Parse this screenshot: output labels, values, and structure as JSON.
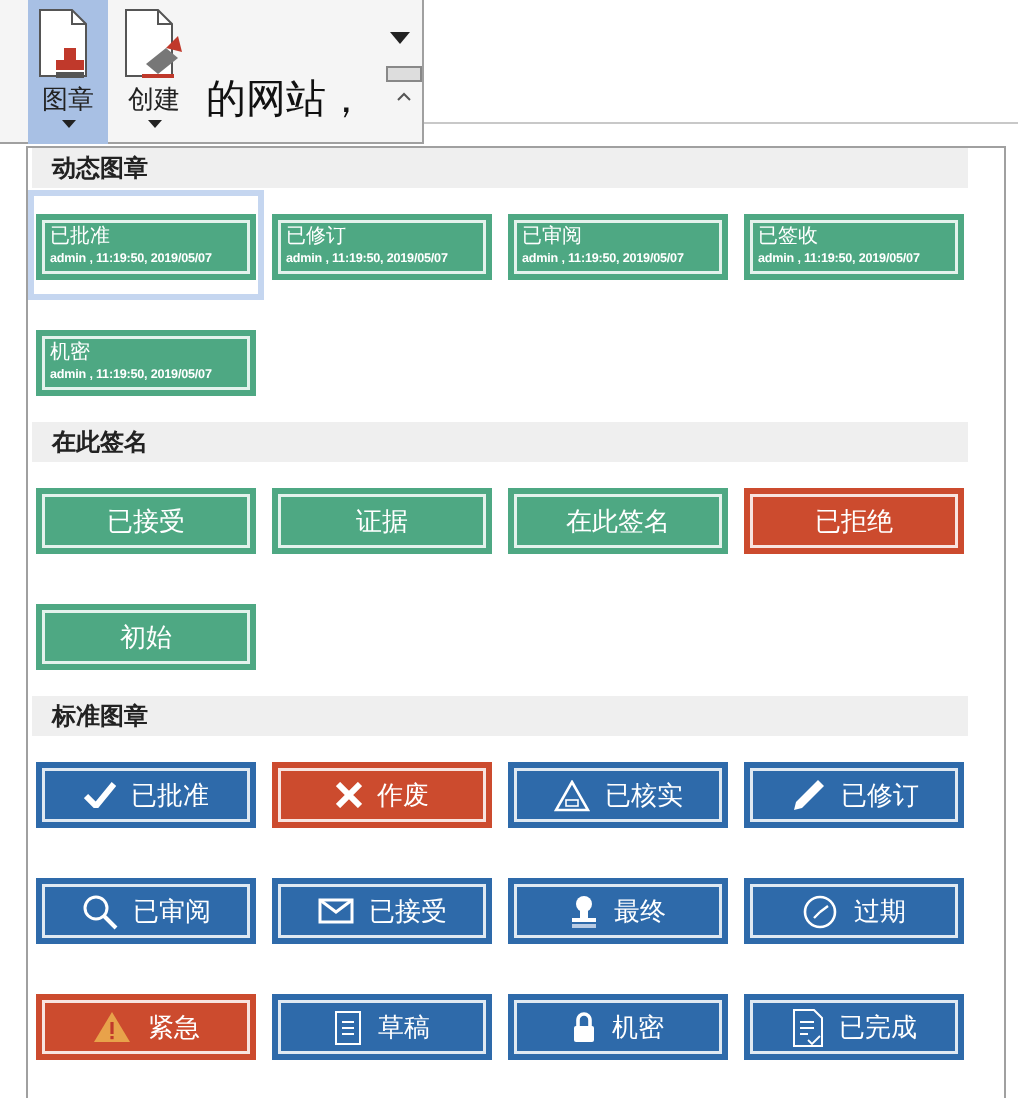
{
  "ribbon": {
    "buttons": [
      {
        "label": "图章",
        "selected": true
      },
      {
        "label": "创建",
        "selected": false
      }
    ]
  },
  "document": {
    "text": "的网站，"
  },
  "menu": {
    "sections": [
      {
        "title": "动态图章",
        "stamps": [
          {
            "kind": "dynamic",
            "label": "已批准",
            "detail": "admin , 11:19:50, 2019/05/07",
            "color": "#4ea883",
            "selected": true
          },
          {
            "kind": "dynamic",
            "label": "已修订",
            "detail": "admin , 11:19:50, 2019/05/07",
            "color": "#4ea883",
            "selected": false
          },
          {
            "kind": "dynamic",
            "label": "已审阅",
            "detail": "admin , 11:19:50, 2019/05/07",
            "color": "#4ea883",
            "selected": false
          },
          {
            "kind": "dynamic",
            "label": "已签收",
            "detail": "admin , 11:19:50, 2019/05/07",
            "color": "#4ea883",
            "selected": false
          },
          {
            "kind": "dynamic",
            "label": "机密",
            "detail": "admin , 11:19:50, 2019/05/07",
            "color": "#4ea883",
            "selected": false
          }
        ]
      },
      {
        "title": "在此签名",
        "stamps": [
          {
            "kind": "plain",
            "label": "已接受",
            "color": "#4ea883",
            "selected": false
          },
          {
            "kind": "plain",
            "label": "证据",
            "color": "#4ea883",
            "selected": false
          },
          {
            "kind": "plain",
            "label": "在此签名",
            "color": "#4ea883",
            "selected": false
          },
          {
            "kind": "plain",
            "label": "已拒绝",
            "color": "#cc4b2e",
            "selected": false
          },
          {
            "kind": "plain",
            "label": "初始",
            "color": "#4ea883",
            "selected": false
          }
        ]
      },
      {
        "title": "标准图章",
        "stamps": [
          {
            "kind": "icon",
            "label": "已批准",
            "color": "#2e6aaa",
            "selected": false
          },
          {
            "kind": "icon",
            "label": "作废",
            "color": "#cc4b2e",
            "selected": false
          },
          {
            "kind": "icon",
            "label": "已核实",
            "color": "#2e6aaa",
            "selected": false
          },
          {
            "kind": "icon",
            "label": "已修订",
            "color": "#2e6aaa",
            "selected": false
          },
          {
            "kind": "icon",
            "label": "已审阅",
            "color": "#2e6aaa",
            "selected": false
          },
          {
            "kind": "icon",
            "label": "已接受",
            "color": "#2e6aaa",
            "selected": false
          },
          {
            "kind": "icon",
            "label": "最终",
            "color": "#2e6aaa",
            "selected": false
          },
          {
            "kind": "icon",
            "label": "过期",
            "color": "#2e6aaa",
            "selected": false
          },
          {
            "kind": "icon",
            "label": "紧急",
            "color": "#cc4b2e",
            "selected": false
          },
          {
            "kind": "icon",
            "label": "草稿",
            "color": "#2e6aaa",
            "selected": false
          },
          {
            "kind": "icon",
            "label": "机密",
            "color": "#2e6aaa",
            "selected": false
          },
          {
            "kind": "icon",
            "label": "已完成",
            "color": "#2e6aaa",
            "selected": false
          }
        ]
      }
    ]
  }
}
